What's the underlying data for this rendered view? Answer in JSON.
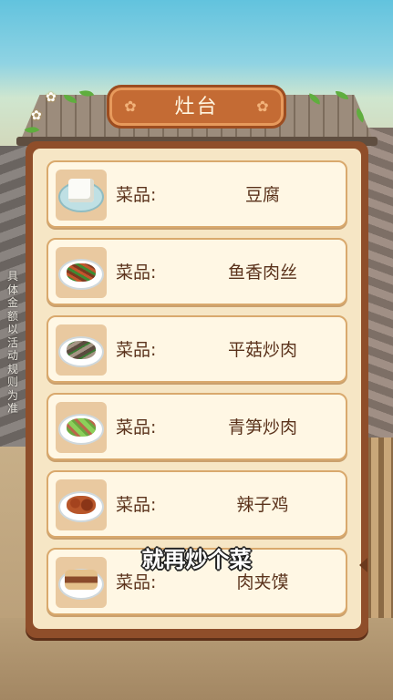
{
  "title": "灶台",
  "side_notice": "具体金额以活动规则为准",
  "dish_label": "菜品:",
  "dishes": [
    {
      "name": "豆腐",
      "icon": "tofu-plate-icon"
    },
    {
      "name": "鱼香肉丝",
      "icon": "shredded-pork-plate-icon"
    },
    {
      "name": "平菇炒肉",
      "icon": "mushroom-pork-plate-icon"
    },
    {
      "name": "青笋炒肉",
      "icon": "lettuce-pork-plate-icon"
    },
    {
      "name": "辣子鸡",
      "icon": "spicy-chicken-plate-icon"
    },
    {
      "name": "肉夹馍",
      "icon": "roujiamo-plate-icon"
    }
  ],
  "subtitle": "就再炒个菜",
  "colors": {
    "panel_border": "#8f4e2a",
    "panel_fill": "#f6e6c5",
    "title_plate": "#c46b34",
    "text_brown": "#5a321b"
  }
}
